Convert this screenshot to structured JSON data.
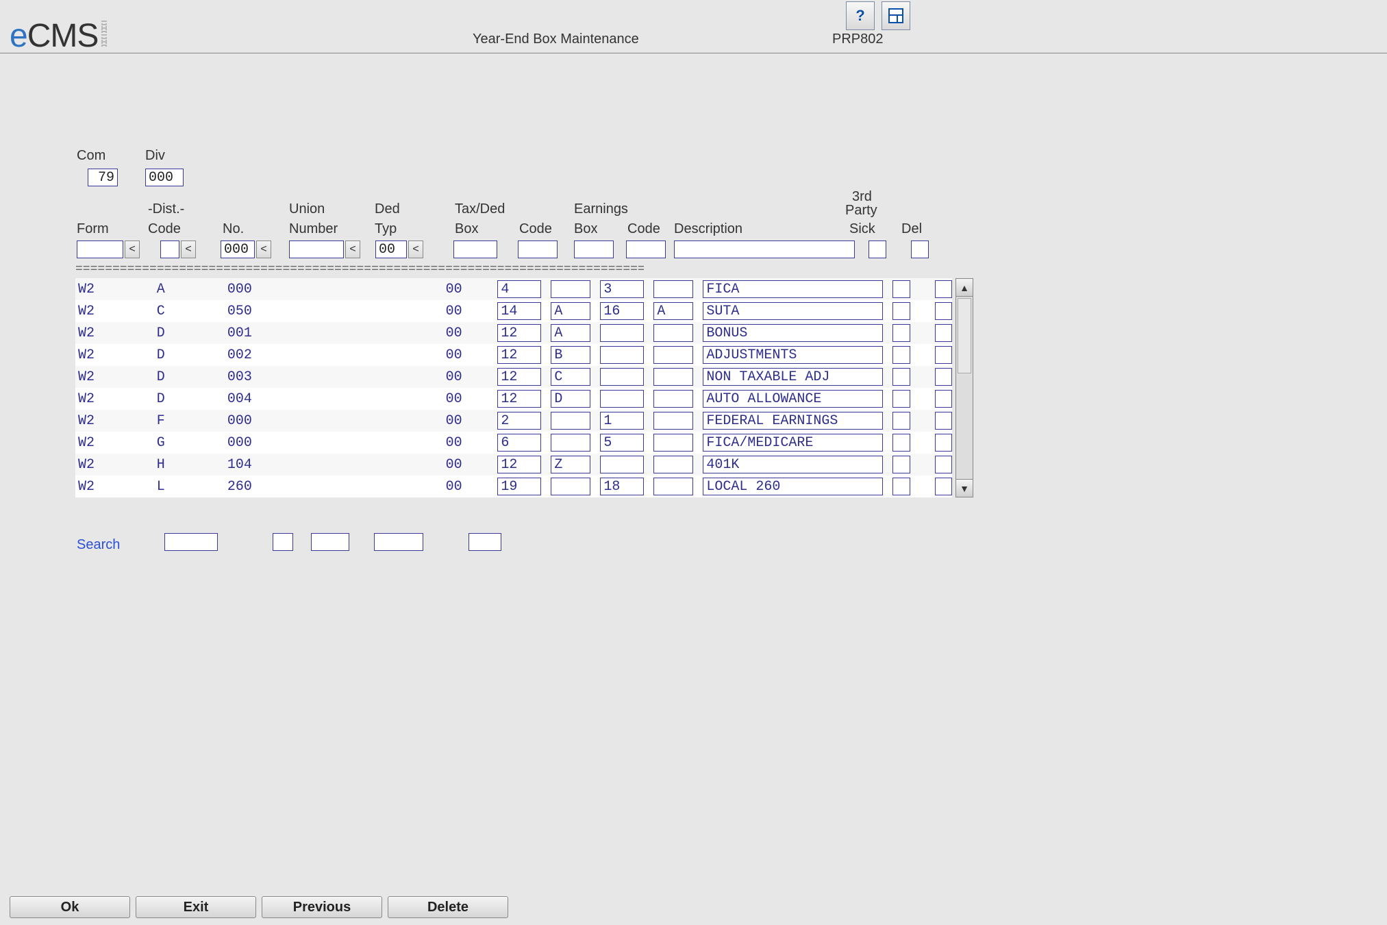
{
  "header": {
    "logo_prefix": "e",
    "logo_rest": "CMS",
    "title": "Year-End Box Maintenance",
    "code": "PRP802",
    "help_icon": "help-icon",
    "layout_icon": "layout-icon"
  },
  "top_fields": {
    "com_label": "Com",
    "com_value": "79",
    "div_label": "Div",
    "div_value": "000"
  },
  "columns": {
    "form": "Form",
    "dist_top": "-Dist.-",
    "dist_code": "Code",
    "dist_no": "No.",
    "union_top": "Union",
    "union_number": "Number",
    "ded_top": "Ded",
    "ded_typ": "Typ",
    "taxded_top": "Tax/Ded",
    "taxded_box": "Box",
    "taxded_code": "Code",
    "earn_top": "Earnings",
    "earn_box": "Box",
    "earn_code": "Code",
    "description": "Description",
    "third_top": "3rd",
    "third_mid": "Party",
    "third_sick": "Sick",
    "del": "Del"
  },
  "filters": {
    "form": "",
    "dist_code": "",
    "dist_no": "000",
    "union_number": "",
    "ded_typ": "00",
    "taxded_box": "",
    "taxded_code": "",
    "earn_box": "",
    "earn_code": "",
    "description": "",
    "sick": "",
    "del": ""
  },
  "rows": [
    {
      "form": "W2",
      "dist_code": "A",
      "dist_no": "000",
      "union": "",
      "ded": "00",
      "td_box": "4",
      "td_code": "",
      "e_box": "3",
      "e_code": "",
      "desc": "FICA"
    },
    {
      "form": "W2",
      "dist_code": "C",
      "dist_no": "050",
      "union": "",
      "ded": "00",
      "td_box": "14",
      "td_code": "A",
      "e_box": "16",
      "e_code": "A",
      "desc": "SUTA"
    },
    {
      "form": "W2",
      "dist_code": "D",
      "dist_no": "001",
      "union": "",
      "ded": "00",
      "td_box": "12",
      "td_code": "A",
      "e_box": "",
      "e_code": "",
      "desc": "BONUS"
    },
    {
      "form": "W2",
      "dist_code": "D",
      "dist_no": "002",
      "union": "",
      "ded": "00",
      "td_box": "12",
      "td_code": "B",
      "e_box": "",
      "e_code": "",
      "desc": "ADJUSTMENTS"
    },
    {
      "form": "W2",
      "dist_code": "D",
      "dist_no": "003",
      "union": "",
      "ded": "00",
      "td_box": "12",
      "td_code": "C",
      "e_box": "",
      "e_code": "",
      "desc": "NON TAXABLE ADJ"
    },
    {
      "form": "W2",
      "dist_code": "D",
      "dist_no": "004",
      "union": "",
      "ded": "00",
      "td_box": "12",
      "td_code": "D",
      "e_box": "",
      "e_code": "",
      "desc": "AUTO ALLOWANCE"
    },
    {
      "form": "W2",
      "dist_code": "F",
      "dist_no": "000",
      "union": "",
      "ded": "00",
      "td_box": "2",
      "td_code": "",
      "e_box": "1",
      "e_code": "",
      "desc": "FEDERAL EARNINGS"
    },
    {
      "form": "W2",
      "dist_code": "G",
      "dist_no": "000",
      "union": "",
      "ded": "00",
      "td_box": "6",
      "td_code": "",
      "e_box": "5",
      "e_code": "",
      "desc": "FICA/MEDICARE"
    },
    {
      "form": "W2",
      "dist_code": "H",
      "dist_no": "104",
      "union": "",
      "ded": "00",
      "td_box": "12",
      "td_code": "Z",
      "e_box": "",
      "e_code": "",
      "desc": "401K"
    },
    {
      "form": "W2",
      "dist_code": "L",
      "dist_no": "260",
      "union": "",
      "ded": "00",
      "td_box": "19",
      "td_code": "",
      "e_box": "18",
      "e_code": "",
      "desc": "LOCAL 260"
    }
  ],
  "search": {
    "label": "Search",
    "f1": "",
    "f2": "",
    "f3": "",
    "f4": "",
    "f5": ""
  },
  "buttons": {
    "ok": "Ok",
    "exit": "Exit",
    "previous": "Previous",
    "delete": "Delete"
  },
  "chevron": "<"
}
